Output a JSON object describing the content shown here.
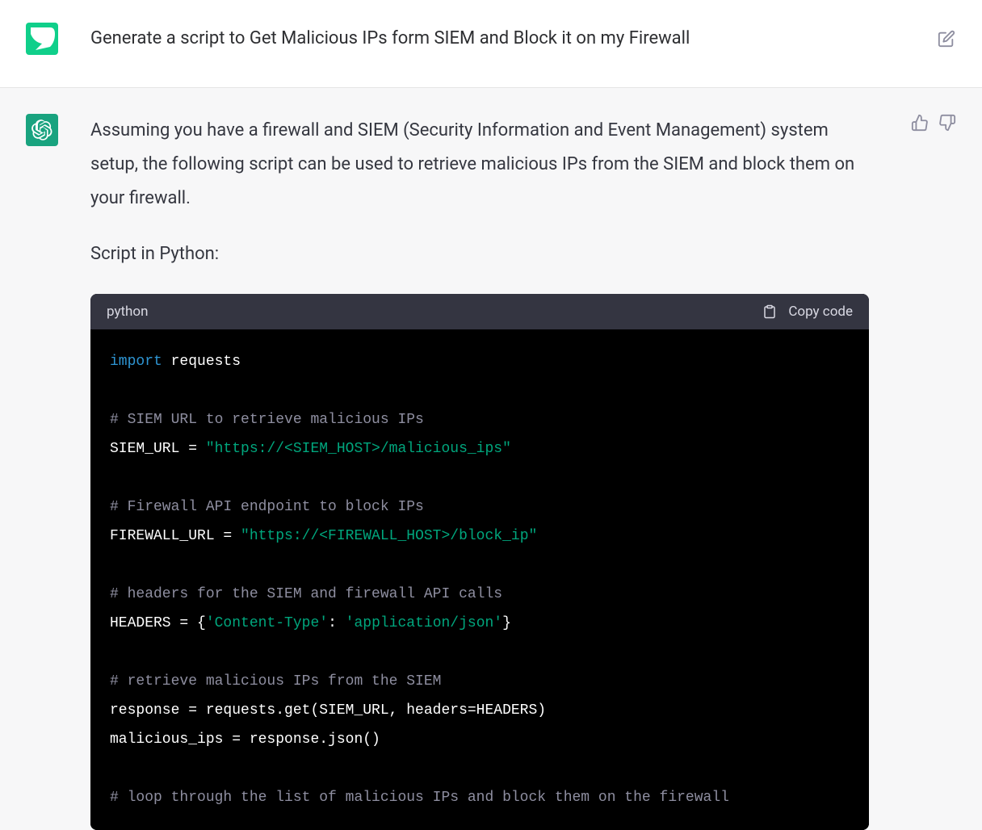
{
  "user": {
    "prompt": "Generate a script to Get Malicious IPs form SIEM and Block it on my Firewall"
  },
  "assistant": {
    "intro": "Assuming you have a firewall and SIEM (Security Information and Event Management) system setup, the following script can be used to retrieve malicious IPs from the SIEM and block them on your firewall.",
    "script_label": "Script in Python:"
  },
  "code": {
    "language": "python",
    "copy_label": "Copy code",
    "tokens": {
      "kw_import": "import",
      "mod_requests": " requests",
      "cm_siem": "# SIEM URL to retrieve malicious IPs",
      "var_siem": "SIEM_URL = ",
      "str_siem": "\"https://<SIEM_HOST>/malicious_ips\"",
      "cm_fw": "# Firewall API endpoint to block IPs",
      "var_fw": "FIREWALL_URL = ",
      "str_fw": "\"https://<FIREWALL_HOST>/block_ip\"",
      "cm_hdr": "# headers for the SIEM and firewall API calls",
      "hdr_pre": "HEADERS = {",
      "hdr_k": "'Content-Type'",
      "hdr_sep": ": ",
      "hdr_v": "'application/json'",
      "hdr_post": "}",
      "cm_ret": "# retrieve malicious IPs from the SIEM",
      "line_resp": "response = requests.get(SIEM_URL, headers=HEADERS)",
      "line_mal": "malicious_ips = response.json()",
      "cm_loop": "# loop through the list of malicious IPs and block them on the firewall"
    }
  }
}
